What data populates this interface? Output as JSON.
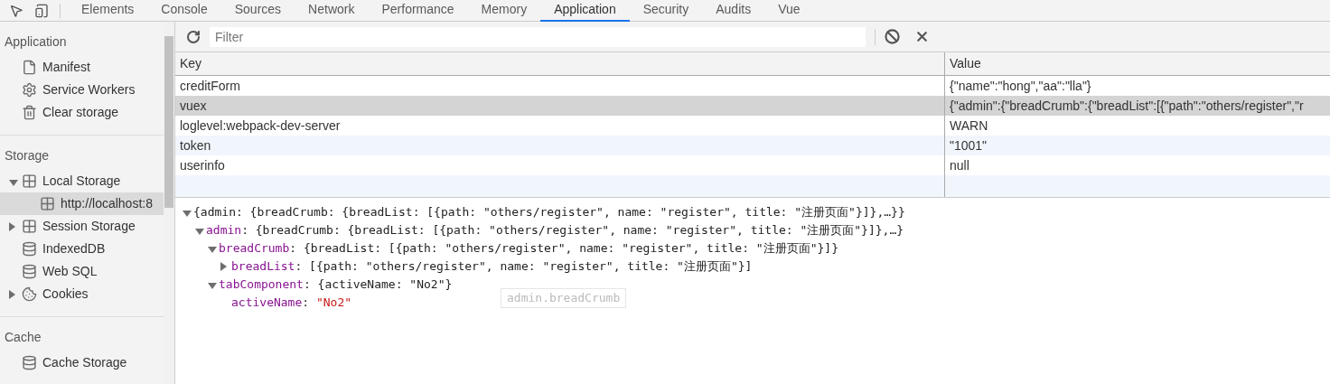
{
  "tabs": [
    {
      "label": "Elements",
      "selected": false
    },
    {
      "label": "Console",
      "selected": false
    },
    {
      "label": "Sources",
      "selected": false
    },
    {
      "label": "Network",
      "selected": false
    },
    {
      "label": "Performance",
      "selected": false
    },
    {
      "label": "Memory",
      "selected": false
    },
    {
      "label": "Application",
      "selected": true
    },
    {
      "label": "Security",
      "selected": false
    },
    {
      "label": "Audits",
      "selected": false
    },
    {
      "label": "Vue",
      "selected": false
    }
  ],
  "sidebar": [
    {
      "title": "Application",
      "items": [
        {
          "label": "Manifest",
          "selected": false
        },
        {
          "label": "Service Workers",
          "selected": false
        },
        {
          "label": "Clear storage",
          "selected": false
        }
      ]
    },
    {
      "title": "Storage",
      "items": [
        {
          "label": "Local Storage",
          "selected": false,
          "expanded": true,
          "children": [
            {
              "label": "http://localhost:8",
              "selected": true
            }
          ]
        },
        {
          "label": "Session Storage",
          "selected": false,
          "expanded": false
        },
        {
          "label": "IndexedDB",
          "selected": false
        },
        {
          "label": "Web SQL",
          "selected": false
        },
        {
          "label": "Cookies",
          "selected": false,
          "expanded": false
        }
      ]
    },
    {
      "title": "Cache",
      "items": [
        {
          "label": "Cache Storage",
          "selected": false
        }
      ]
    }
  ],
  "filter": {
    "placeholder": "Filter"
  },
  "table": {
    "columns": [
      "Key",
      "Value"
    ],
    "rows": [
      {
        "key": "creditForm",
        "value": "{\"name\":\"hong\",\"aa\":\"lla\"}",
        "selected": false
      },
      {
        "key": "vuex",
        "value": "{\"admin\":{\"breadCrumb\":{\"breadList\":[{\"path\":\"others/register\",\"r",
        "selected": true
      },
      {
        "key": "loglevel:webpack-dev-server",
        "value": "WARN",
        "selected": false
      },
      {
        "key": "token",
        "value": "\"1001\"",
        "selected": false
      },
      {
        "key": "userinfo",
        "value": "null",
        "selected": false
      }
    ]
  },
  "preview": {
    "tree": [
      {
        "value": "{admin: {breadCrumb: {breadList: [{path: \"others/register\", name: \"register\", title: \"注册页面\"}]},…}}",
        "expanded": true,
        "children": [
          {
            "key": "admin",
            "sep": ":",
            "value": "{breadCrumb: {breadList: [{path: \"others/register\", name: \"register\", title: \"注册页面\"}]},…}",
            "expanded": true,
            "children": [
              {
                "key": "breadCrumb",
                "sep": ":",
                "value": "{breadList: [{path: \"others/register\", name: \"register\", title: \"注册页面\"}]}",
                "expanded": true,
                "children": [
                  {
                    "key": "breadList",
                    "sep": ":",
                    "value": "[{path: \"others/register\", name: \"register\", title: \"注册页面\"}]",
                    "expanded": false
                  }
                ]
              },
              {
                "key": "tabComponent",
                "sep": ":",
                "value": "{activeName: \"No2\"}",
                "expanded": true,
                "children": [
                  {
                    "key": "activeName",
                    "sep": ":",
                    "value": "\"No2\"",
                    "kind": "string"
                  }
                ]
              }
            ]
          }
        ]
      }
    ],
    "tooltip": "admin.breadCrumb"
  }
}
